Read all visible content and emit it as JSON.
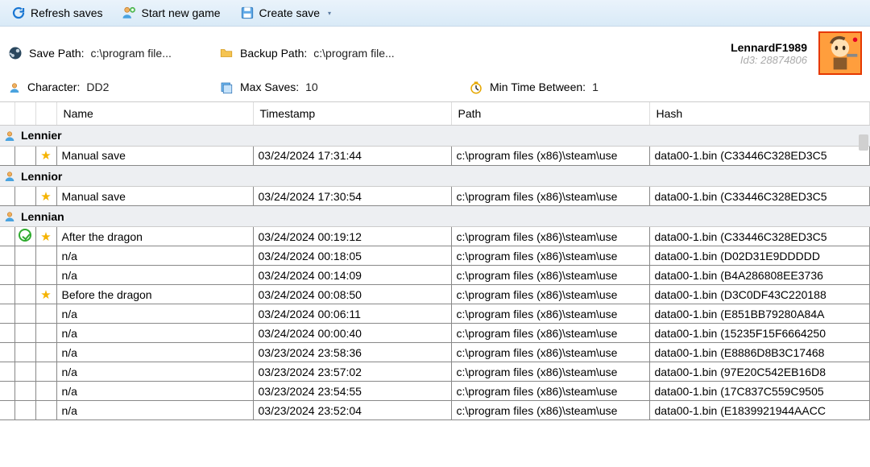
{
  "toolbar": {
    "refresh": "Refresh saves",
    "newgame": "Start new game",
    "createsave": "Create save"
  },
  "info": {
    "save_path_label": "Save Path:",
    "save_path_value": "c:\\program file...",
    "backup_path_label": "Backup Path:",
    "backup_path_value": "c:\\program file...",
    "character_label": "Character:",
    "character_value": "DD2",
    "max_saves_label": "Max Saves:",
    "max_saves_value": "10",
    "min_time_label": "Min Time Between:",
    "min_time_value": "1"
  },
  "user": {
    "name": "LennardF1989",
    "id_label": "Id3: 28874806"
  },
  "columns": {
    "name": "Name",
    "timestamp": "Timestamp",
    "path": "Path",
    "hash": "Hash"
  },
  "groups": [
    {
      "title": "Lennier",
      "rows": [
        {
          "starred": true,
          "ok": false,
          "name": "Manual save",
          "ts": "03/24/2024 17:31:44",
          "path": "c:\\program files (x86)\\steam\\use",
          "hash": "data00-1.bin (C33446C328ED3C5"
        }
      ]
    },
    {
      "title": "Lennior",
      "rows": [
        {
          "starred": true,
          "ok": false,
          "name": "Manual save",
          "ts": "03/24/2024 17:30:54",
          "path": "c:\\program files (x86)\\steam\\use",
          "hash": "data00-1.bin (C33446C328ED3C5"
        }
      ]
    },
    {
      "title": "Lennian",
      "rows": [
        {
          "starred": true,
          "ok": true,
          "name": "After the dragon",
          "ts": "03/24/2024 00:19:12",
          "path": "c:\\program files (x86)\\steam\\use",
          "hash": "data00-1.bin (C33446C328ED3C5"
        },
        {
          "starred": false,
          "ok": false,
          "name": "n/a",
          "ts": "03/24/2024 00:18:05",
          "path": "c:\\program files (x86)\\steam\\use",
          "hash": "data00-1.bin (D02D31E9DDDDD"
        },
        {
          "starred": false,
          "ok": false,
          "name": "n/a",
          "ts": "03/24/2024 00:14:09",
          "path": "c:\\program files (x86)\\steam\\use",
          "hash": "data00-1.bin (B4A286808EE3736"
        },
        {
          "starred": true,
          "ok": false,
          "name": "Before the dragon",
          "ts": "03/24/2024 00:08:50",
          "path": "c:\\program files (x86)\\steam\\use",
          "hash": "data00-1.bin (D3C0DF43C220188"
        },
        {
          "starred": false,
          "ok": false,
          "name": "n/a",
          "ts": "03/24/2024 00:06:11",
          "path": "c:\\program files (x86)\\steam\\use",
          "hash": "data00-1.bin (E851BB79280A84A"
        },
        {
          "starred": false,
          "ok": false,
          "name": "n/a",
          "ts": "03/24/2024 00:00:40",
          "path": "c:\\program files (x86)\\steam\\use",
          "hash": "data00-1.bin (15235F15F6664250"
        },
        {
          "starred": false,
          "ok": false,
          "name": "n/a",
          "ts": "03/23/2024 23:58:36",
          "path": "c:\\program files (x86)\\steam\\use",
          "hash": "data00-1.bin (E8886D8B3C17468"
        },
        {
          "starred": false,
          "ok": false,
          "name": "n/a",
          "ts": "03/23/2024 23:57:02",
          "path": "c:\\program files (x86)\\steam\\use",
          "hash": "data00-1.bin (97E20C542EB16D8"
        },
        {
          "starred": false,
          "ok": false,
          "name": "n/a",
          "ts": "03/23/2024 23:54:55",
          "path": "c:\\program files (x86)\\steam\\use",
          "hash": "data00-1.bin (17C837C559C9505"
        },
        {
          "starred": false,
          "ok": false,
          "name": "n/a",
          "ts": "03/23/2024 23:52:04",
          "path": "c:\\program files (x86)\\steam\\use",
          "hash": "data00-1.bin (E1839921944AACC"
        }
      ]
    }
  ]
}
